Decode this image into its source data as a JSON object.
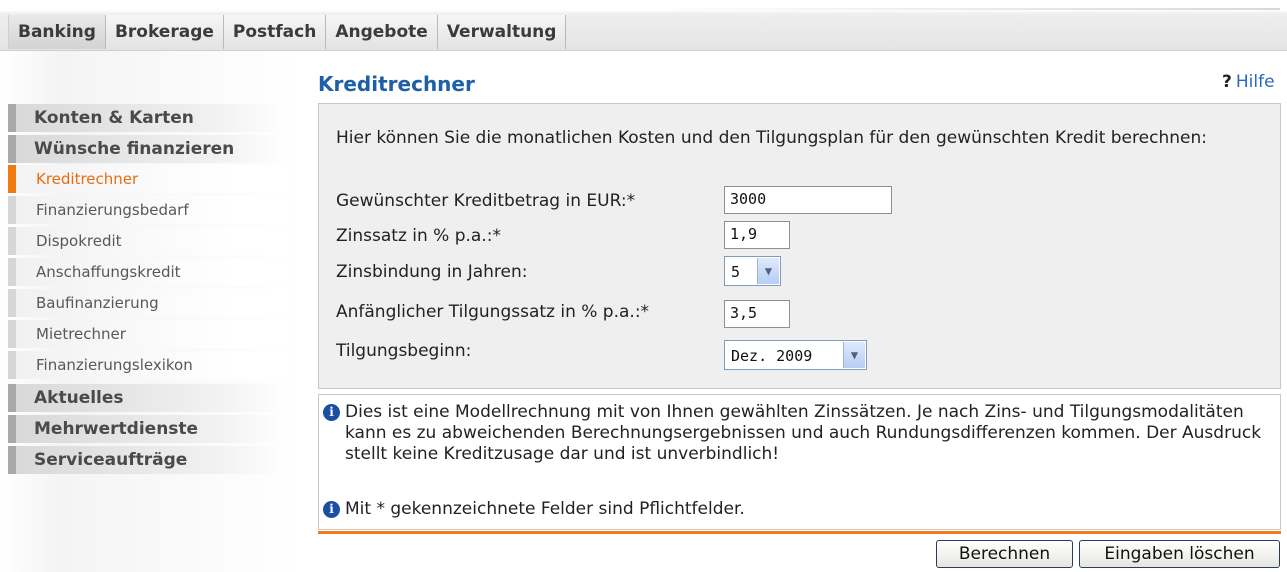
{
  "tabs": [
    "Banking",
    "Brokerage",
    "Postfach",
    "Angebote",
    "Verwaltung"
  ],
  "sidebar": {
    "konten": "Konten & Karten",
    "wuensche": "Wünsche finanzieren",
    "items": [
      "Kreditrechner",
      "Finanzierungsbedarf",
      "Dispokredit",
      "Anschaffungskredit",
      "Baufinanzierung",
      "Mietrechner",
      "Finanzierungslexikon"
    ],
    "aktuelles": "Aktuelles",
    "mehrwert": "Mehrwertdienste",
    "service": "Serviceaufträge"
  },
  "main": {
    "title": "Kreditrechner",
    "help_icon": "?",
    "help_label": "Hilfe",
    "intro": "Hier können Sie die monatlichen Kosten und den Tilgungsplan für den gewünschten Kredit berechnen:",
    "fields": {
      "betrag_label": "Gewünschter Kreditbetrag in EUR:*",
      "betrag_value": "3000",
      "zinssatz_label": "Zinssatz in % p.a.:*",
      "zinssatz_value": "1,9",
      "zinsbindung_label": "Zinsbindung in Jahren:",
      "zinsbindung_value": "5",
      "tilgungssatz_label": "Anfänglicher Tilgungssatz in % p.a.:*",
      "tilgungssatz_value": "3,5",
      "tilgungsbeginn_label": "Tilgungsbeginn:",
      "tilgungsbeginn_value": "Dez. 2009"
    },
    "info1": "Dies ist eine Modellrechnung mit von Ihnen gewählten Zinssätzen. Je nach Zins- und Tilgungsmodalitäten kann es zu abweichenden Berechnungsergebnissen und auch Rundungsdifferenzen kommen. Der Ausdruck stellt keine Kreditzusage dar und ist unverbindlich!",
    "info2": "Mit * gekennzeichnete Felder sind Pflichtfelder.",
    "info_icon": "i",
    "berechnen": "Berechnen",
    "loeschen": "Eingaben löschen"
  },
  "colors": {
    "accent_orange": "#f37a1c",
    "title_blue": "#1f5fa6",
    "info_icon_blue": "#1c4fa4"
  }
}
